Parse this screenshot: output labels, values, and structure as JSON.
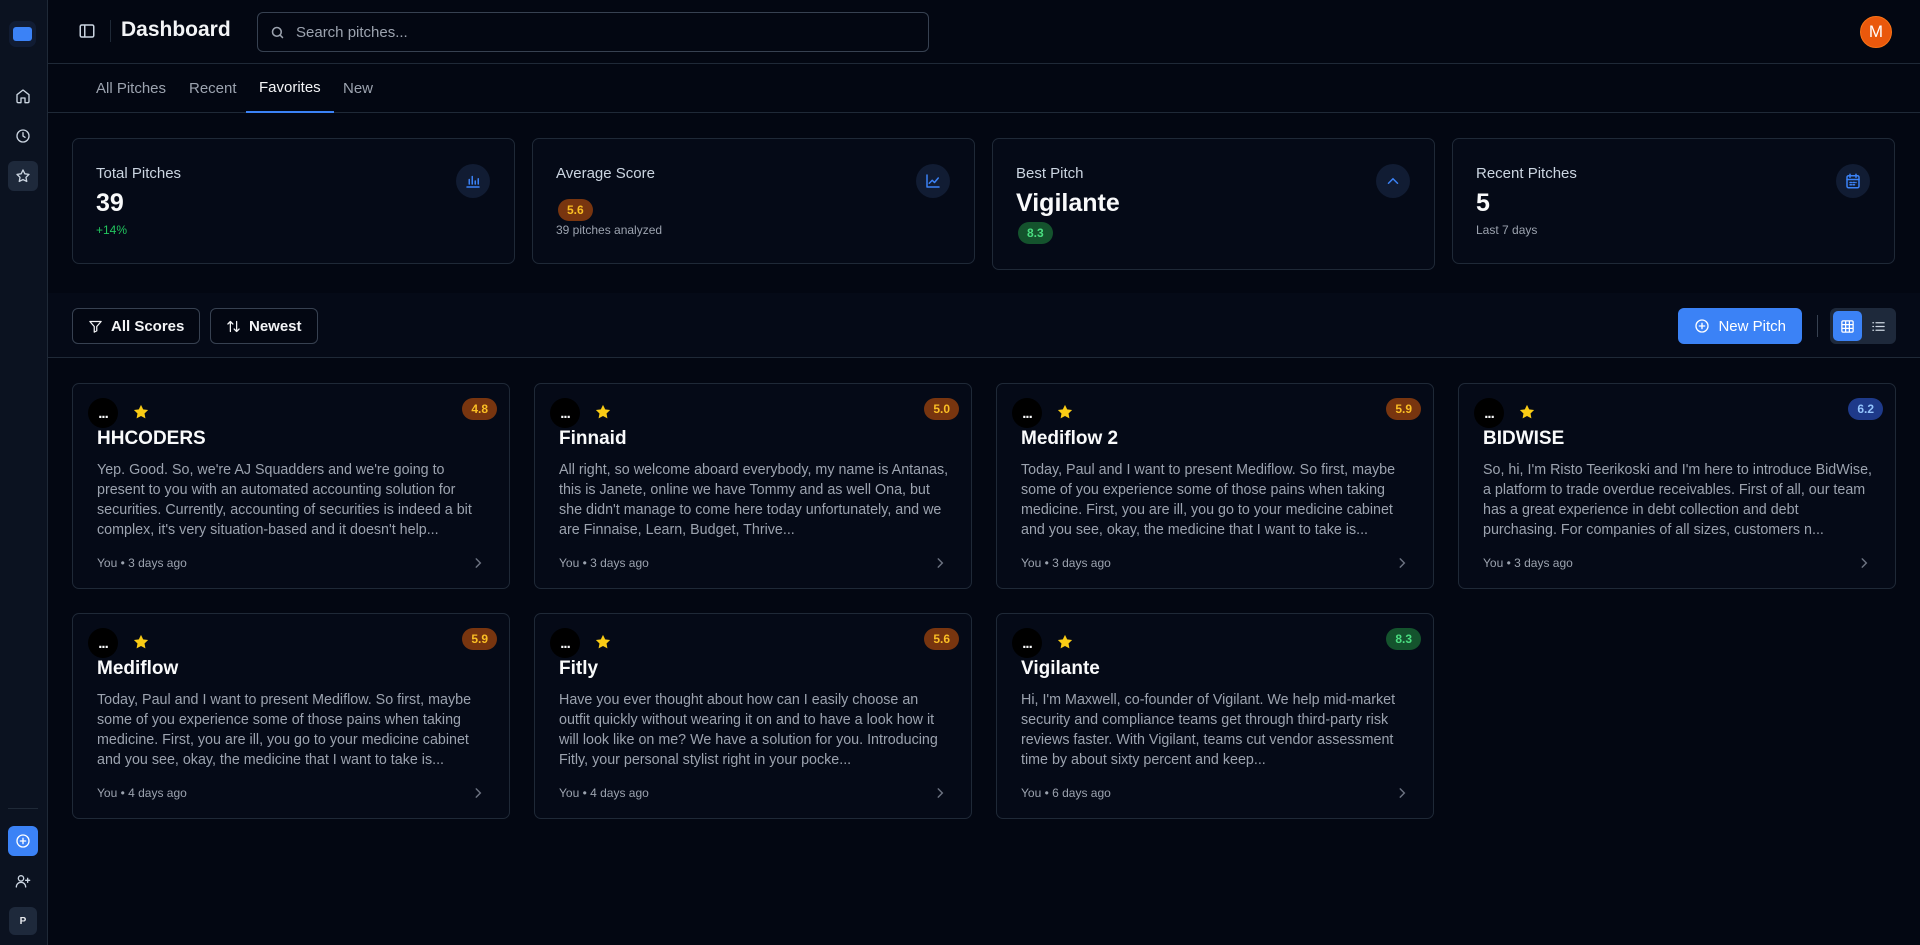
{
  "header": {
    "title": "Dashboard",
    "search_placeholder": "Search pitches...",
    "user_initial": "M"
  },
  "sidebar": {
    "workspace_initial": "P",
    "items": [
      "home-icon",
      "clock-icon",
      "star-icon"
    ],
    "bottom": [
      "plus-circle-icon",
      "user-plus-icon"
    ]
  },
  "tabs": [
    "All Pitches",
    "Recent",
    "Favorites",
    "New"
  ],
  "active_tab": "Favorites",
  "stats": {
    "total": {
      "label": "Total Pitches",
      "value": "39",
      "sub": "+14%"
    },
    "average": {
      "label": "Average Score",
      "badge": "5.6",
      "sub": "39 pitches analyzed"
    },
    "best": {
      "label": "Best Pitch",
      "value": "Vigilante",
      "badge": "8.3"
    },
    "recent": {
      "label": "Recent Pitches",
      "value": "5",
      "sub": "Last 7 days"
    }
  },
  "toolbar": {
    "filter_label": "All Scores",
    "sort_label": "Newest",
    "new_pitch_label": "New Pitch",
    "view_mode": "grid"
  },
  "colors": {
    "accent": "#3b82f6",
    "score_amber": "#fbbf24",
    "score_green": "#4ade80",
    "score_blue": "#93c5fd",
    "favorite_star": "#facc15"
  },
  "cards": [
    {
      "menu": "...",
      "title": "HHCODERS",
      "score": "4.8",
      "text": "Yep. Good. So, we're AJ Squadders and we're going to present to you with an automated accounting solution for securities. Currently, accounting of securities is indeed a bit complex, it's very situation-based and it doesn't help...",
      "meta": "You • 3 days ago"
    },
    {
      "menu": "...",
      "title": "Finnaid",
      "score": "5.0",
      "text": "All right, so welcome aboard everybody, my name is Antanas, this is Janete, online we have Tommy and as well Ona, but she didn't manage to come here today unfortunately, and we are Finnaise, Learn, Budget, Thrive...",
      "meta": "You • 3 days ago"
    },
    {
      "menu": "...",
      "title": "Mediflow 2",
      "score": "5.9",
      "text": "Today, Paul and I want to present Mediflow. So first, maybe some of you experience some of those pains when taking medicine. First, you are ill, you go to your medicine cabinet and you see, okay, the medicine that I want to take is...",
      "meta": "You • 3 days ago"
    },
    {
      "menu": "...",
      "title": "BIDWISE",
      "score": "6.2",
      "text": "So, hi, I'm Risto Teerikoski and I'm here to introduce BidWise, a platform to trade overdue receivables. First of all, our team has a great experience in debt collection and debt purchasing. For companies of all sizes, customers n...",
      "meta": "You • 3 days ago"
    },
    {
      "menu": "...",
      "title": "Mediflow",
      "score": "5.9",
      "text": "Today, Paul and I want to present Mediflow. So first, maybe some of you experience some of those pains when taking medicine. First, you are ill, you go to your medicine cabinet and you see, okay, the medicine that I want to take is...",
      "meta": "You • 4 days ago"
    },
    {
      "menu": "...",
      "title": "Fitly",
      "score": "5.6",
      "text": "Have you ever thought about how can I easily choose an outfit quickly without wearing it on and to have a look how it will look like on me? We have a solution for you. Introducing Fitly, your personal stylist right in your pocke...",
      "meta": "You • 4 days ago"
    },
    {
      "menu": "...",
      "title": "Vigilante",
      "score": "8.3",
      "text": "Hi, I'm Maxwell, co-founder of Vigilant. We help mid-market security and compliance teams get through third-party risk reviews faster. With Vigilant, teams cut vendor assessment time by about sixty percent and keep...",
      "meta": "You • 6 days ago"
    }
  ]
}
